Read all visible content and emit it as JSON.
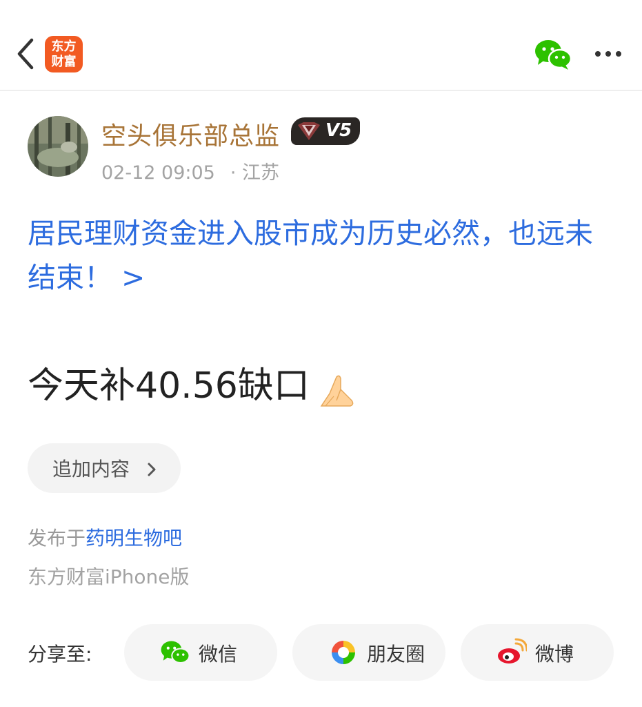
{
  "header": {
    "logo_line1": "东方",
    "logo_line2": "财富",
    "icons": [
      "back-chevron-icon",
      "wechat-icon",
      "more-dots-icon"
    ]
  },
  "post": {
    "author": "空头俱乐部总监",
    "badge": "V5",
    "date": "02-12 09:05",
    "location": "· 江苏",
    "headline": "居民理财资金进入股市成为历史必然，也远未结束！ >",
    "body": "今天补40.56缺口",
    "add_content_label": "追加内容"
  },
  "footer": {
    "posted_prefix": "发布于",
    "forum_link": "药明生物吧",
    "client": "东方财富iPhone版"
  },
  "share": {
    "label": "分享至:",
    "buttons": [
      {
        "label": "微信",
        "icon": "wechat-icon"
      },
      {
        "label": "朋友圈",
        "icon": "moments-icon"
      },
      {
        "label": "微博",
        "icon": "weibo-icon"
      }
    ]
  },
  "colors": {
    "brand_orange": "#f25a22",
    "link_blue": "#2d6cdf",
    "author_gold": "#a87437",
    "wechat_green": "#2dc100"
  }
}
